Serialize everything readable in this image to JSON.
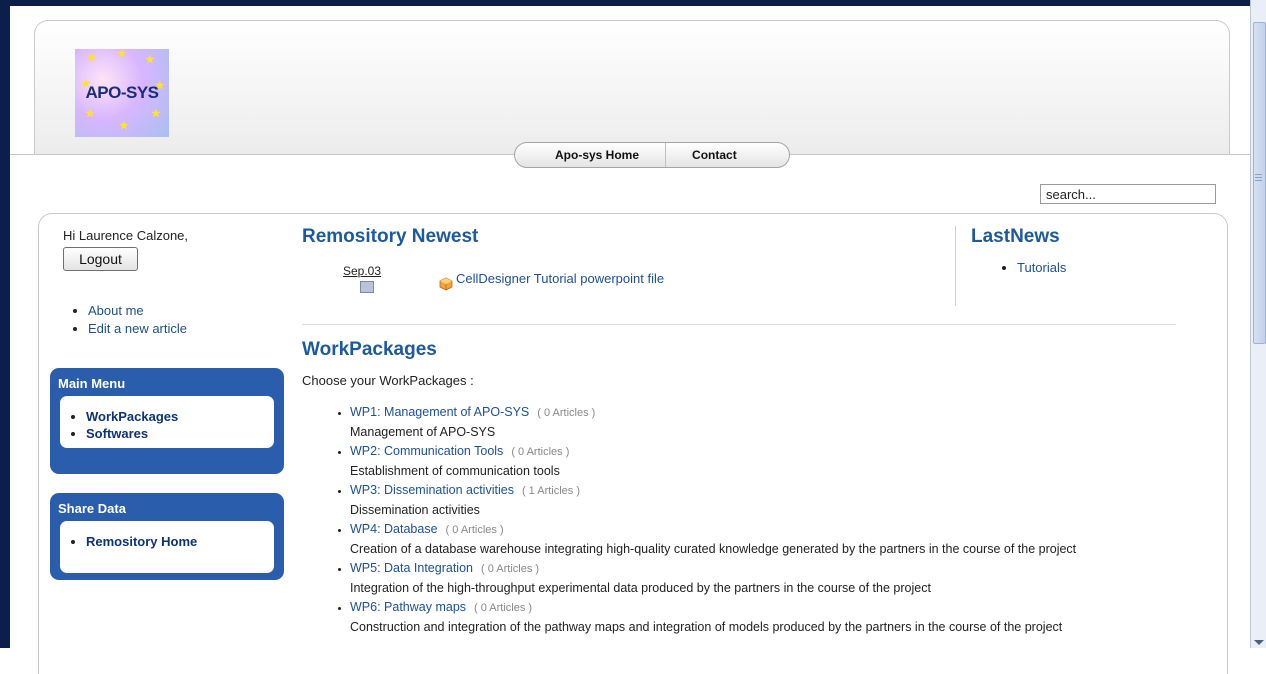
{
  "site": {
    "logo_text": "APO-SYS",
    "nav": [
      "Apo-sys Home",
      "Contact"
    ],
    "search_value": "search..."
  },
  "user": {
    "greeting": "Hi Laurence Calzone,",
    "logout_label": "Logout",
    "links": [
      "About me",
      "Edit a new article"
    ]
  },
  "main_menu": {
    "title": "Main Menu",
    "items": [
      "WorkPackages",
      "Softwares"
    ]
  },
  "share_data": {
    "title": "Share Data",
    "items": [
      "Remository Home"
    ]
  },
  "remository": {
    "title": "Remository Newest",
    "date": "Sep.03",
    "file": "CellDesigner Tutorial powerpoint file"
  },
  "lastnews": {
    "title": "LastNews",
    "items": [
      "Tutorials"
    ]
  },
  "workpackages": {
    "title": "WorkPackages",
    "intro": "Choose your WorkPackages :",
    "items": [
      {
        "name": "WP1: Management of APO-SYS",
        "count": "( 0 Articles )",
        "desc": "Management of APO-SYS"
      },
      {
        "name": "WP2: Communication Tools",
        "count": "( 0 Articles )",
        "desc": "Establishment of communication tools"
      },
      {
        "name": "WP3: Dissemination activities",
        "count": "( 1 Articles )",
        "desc": "Dissemination activities"
      },
      {
        "name": "WP4: Database",
        "count": "( 0 Articles )",
        "desc": "Creation of a database warehouse integrating high-quality curated knowledge generated by the partners in the course of the project"
      },
      {
        "name": "WP5: Data Integration",
        "count": "( 0 Articles )",
        "desc": "Integration of the high-throughput experimental data produced by the partners in the course of the project"
      },
      {
        "name": "WP6: Pathway maps",
        "count": "( 0 Articles )",
        "desc": "Construction and integration of the pathway maps and integration of models produced by the partners in the course of the project"
      }
    ]
  },
  "colors": {
    "frame": "#0b1f4a",
    "module": "#2a5eac",
    "heading": "#1c5a9e",
    "link": "#1c4f9a"
  }
}
